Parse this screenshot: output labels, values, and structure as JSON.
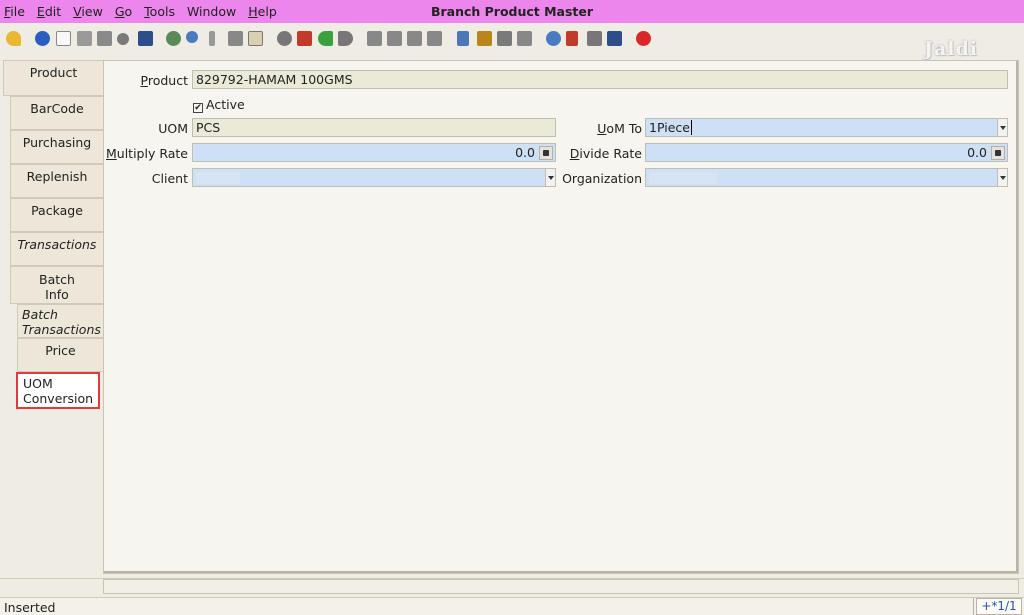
{
  "menu": [
    {
      "key": "F",
      "rest": "ile"
    },
    {
      "key": "E",
      "rest": "dit"
    },
    {
      "key": "V",
      "rest": "iew"
    },
    {
      "key": "G",
      "rest": "o"
    },
    {
      "key": "T",
      "rest": "ools"
    },
    {
      "key": "",
      "rest": "Window"
    },
    {
      "key": "H",
      "rest": "elp"
    }
  ],
  "window_title": "Branch Product Master",
  "logo_text": "Jaldi",
  "toolbar_icons": [
    "undo-icon",
    "help-icon",
    "new-icon",
    "copy-icon",
    "delete-icon",
    "tools-icon",
    "save-icon",
    "refresh-icon",
    "find-icon",
    "attachment-icon",
    "chat-icon",
    "history-icon",
    "archive-icon",
    "home-icon",
    "back-icon",
    "forward-icon",
    "first-record-icon",
    "previous-record-icon",
    "next-record-icon",
    "last-record-icon",
    "report-icon",
    "print-preview-icon",
    "print-icon",
    "request-icon",
    "zoom-icon",
    "workflow-icon",
    "product-icon",
    "end-icon",
    "close-icon"
  ],
  "tabs": [
    {
      "l1": "Product",
      "l2": "",
      "italic": false
    },
    {
      "l1": "BarCode",
      "l2": "",
      "italic": false
    },
    {
      "l1": "Purchasing",
      "l2": "",
      "italic": false
    },
    {
      "l1": "Replenish",
      "l2": "",
      "italic": false
    },
    {
      "l1": "Package",
      "l2": "",
      "italic": false
    },
    {
      "l1": "Transactions",
      "l2": "",
      "italic": true
    },
    {
      "l1": "Batch",
      "l2": "Info",
      "italic": false
    },
    {
      "l1": "Batch",
      "l2": "Transactions",
      "italic": true
    },
    {
      "l1": "Price",
      "l2": "",
      "italic": false
    },
    {
      "l1": "UOM",
      "l2": "Conversion",
      "italic": false,
      "selected": true
    }
  ],
  "form": {
    "product_label_key": "P",
    "product_label_rest": "roduct",
    "product_value": "829792-HAMAM 100GMS",
    "active_label": "Active",
    "active_checked": true,
    "uom_label": "UOM",
    "uom_value": "PCS",
    "uom_to_label_key": "U",
    "uom_to_label_rest": "oM To",
    "uom_to_value": "1Piece",
    "multiply_label_key": "M",
    "multiply_label_rest": "ultiply Rate",
    "multiply_value": "0.0",
    "divide_label_key": "D",
    "divide_label_rest": "ivide Rate",
    "divide_value": "0.0",
    "client_label": "Client",
    "org_label": "Organization"
  },
  "status": {
    "text": "Inserted",
    "record": "+*1/1"
  }
}
